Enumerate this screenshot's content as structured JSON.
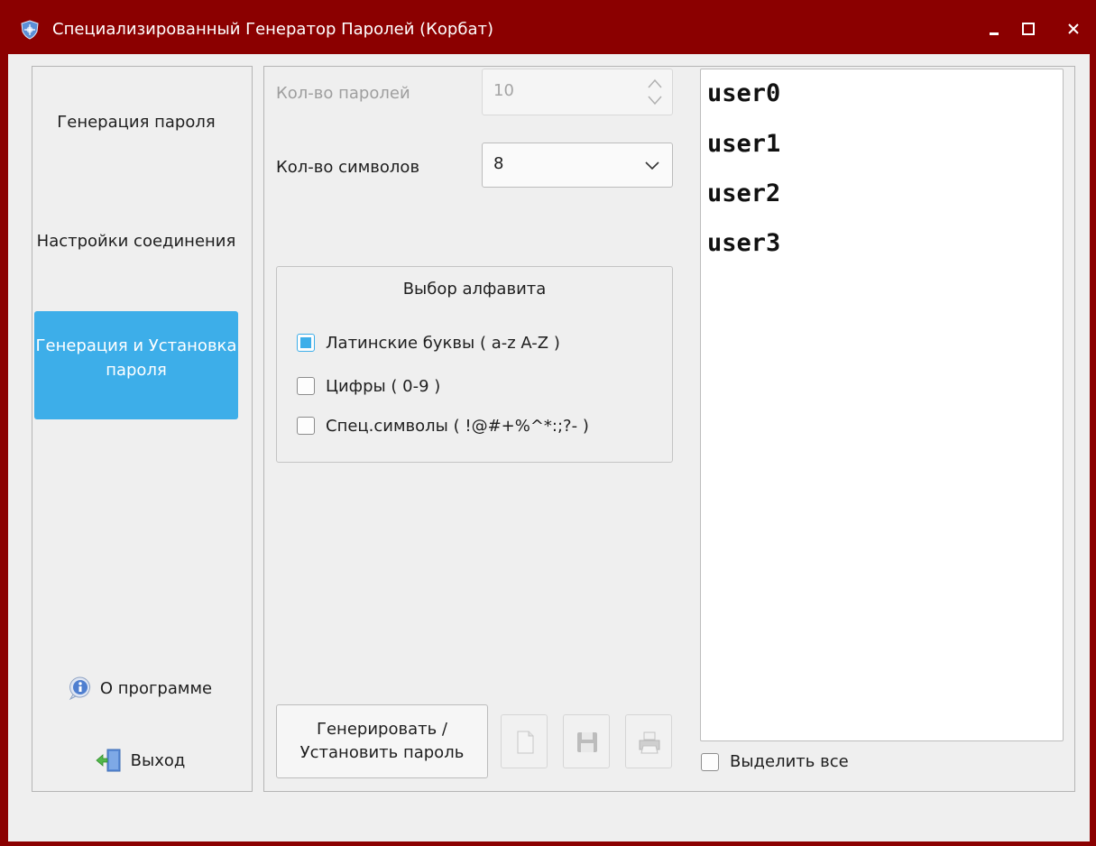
{
  "window": {
    "title": "Специализированный Генератор Паролей (Корбат)",
    "app_icon": "shield-icon",
    "controls": [
      "minimize-icon",
      "maximize-icon",
      "close-icon"
    ]
  },
  "nav": {
    "items": [
      {
        "label": "Генерация пароля",
        "active": false
      },
      {
        "label": "Настройки соединения",
        "active": false
      },
      {
        "label": "Генерация и Установка пароля",
        "active": true
      }
    ],
    "about": {
      "label": "О программе",
      "icon": "info-icon"
    },
    "exit": {
      "label": "Выход",
      "icon": "exit-door-icon"
    },
    "active_color": "#3daee9"
  },
  "form": {
    "count": {
      "label": "Кол-во паролей",
      "value": "10",
      "enabled": false
    },
    "chars": {
      "label": "Кол-во символов",
      "value": "8"
    },
    "alphabet": {
      "title": "Выбор алфавита",
      "options": [
        {
          "label": "Латинские буквы ( a-z A-Z )",
          "checked": true
        },
        {
          "label": "Цифры ( 0-9 )",
          "checked": false
        },
        {
          "label": "Спец.символы ( !@#+%^*:;?- )",
          "checked": false
        }
      ]
    },
    "generate_button": {
      "line1": "Генерировать /",
      "line2": "Установить пароль"
    },
    "tools": [
      "new-document-icon",
      "save-icon",
      "print-icon"
    ]
  },
  "output": {
    "lines": [
      "user0",
      "user1",
      "user2",
      "user3"
    ],
    "select_all": {
      "label": "Выделить все",
      "checked": false
    }
  }
}
